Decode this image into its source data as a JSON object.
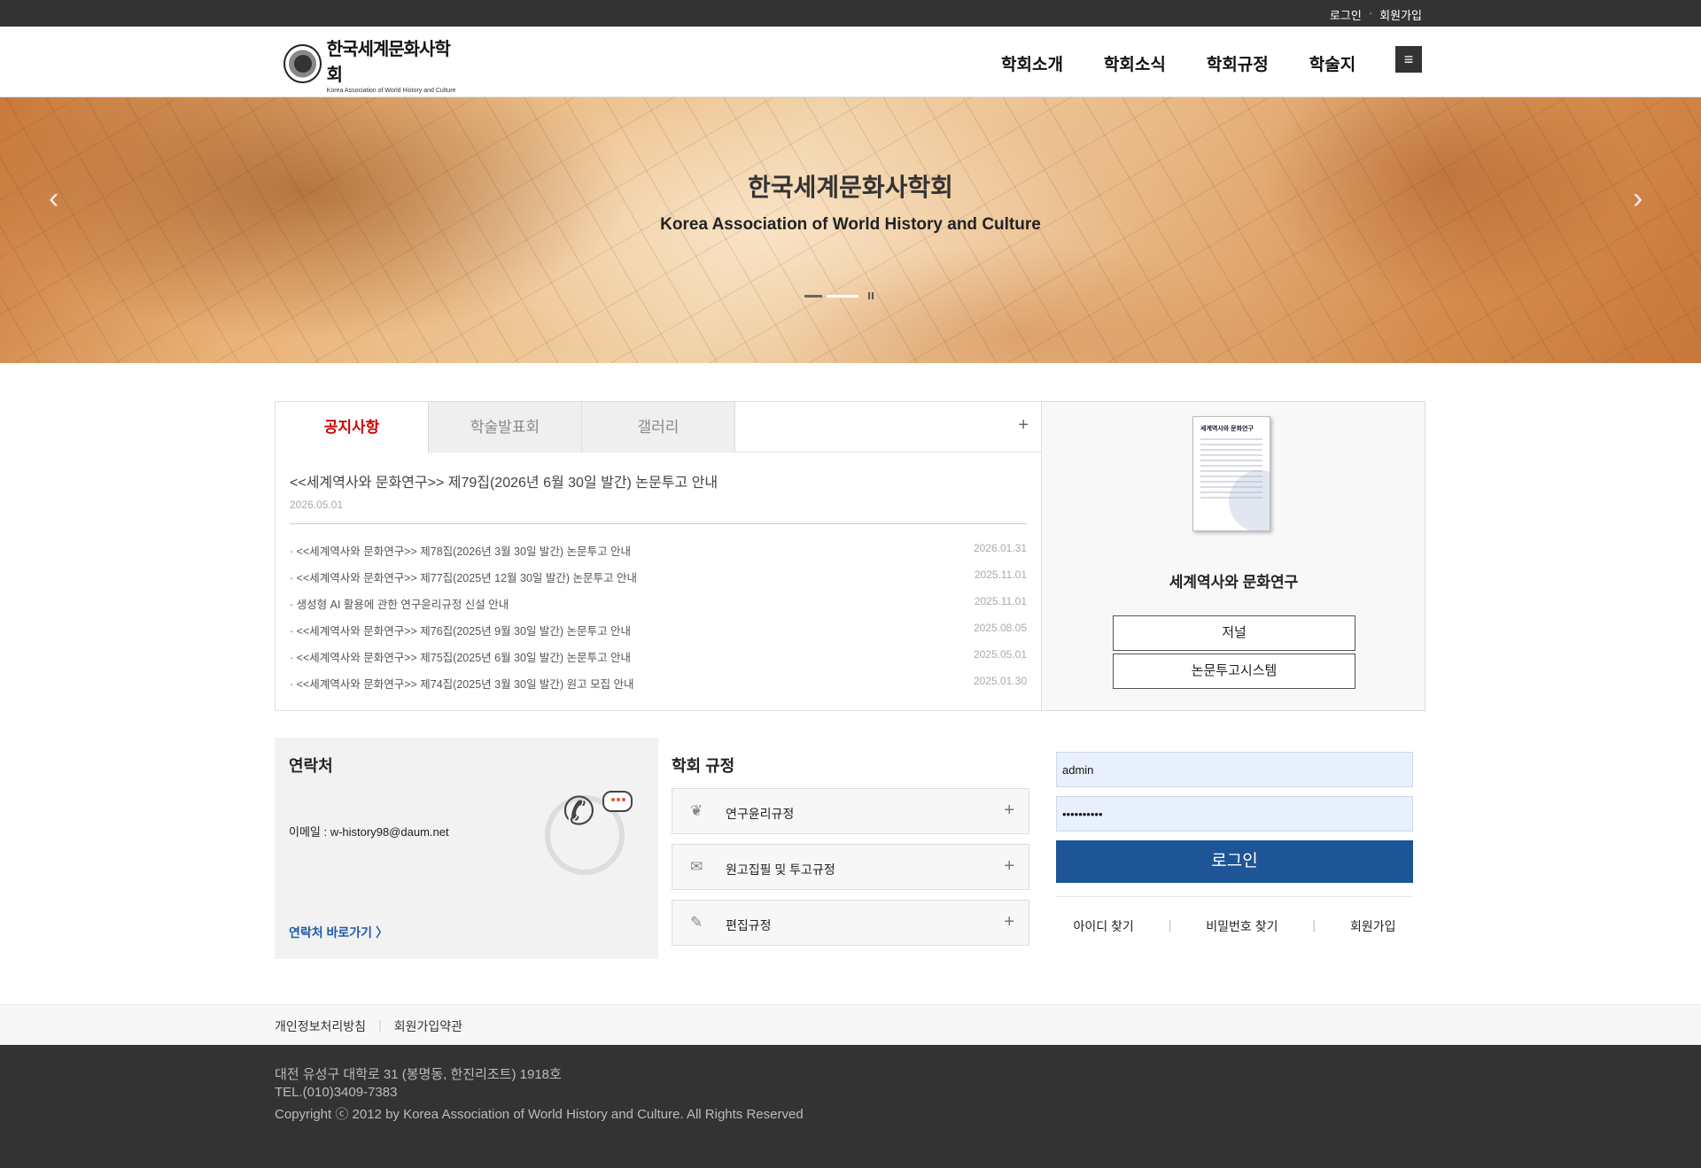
{
  "topbar": {
    "login": "로그인",
    "sep": "·",
    "join": "회원가입"
  },
  "header": {
    "logo_ko": "한국세계문화사학회",
    "logo_en": "Korea Association of World History and Culture",
    "nav": [
      "학회소개",
      "학회소식",
      "학회규정",
      "학술지"
    ],
    "menu_icon": "hamburger-icon"
  },
  "hero": {
    "title": "한국세계문화사학회",
    "subtitle": "Korea Association of World History and Culture",
    "prev": "‹",
    "next": "›",
    "slide_count": 2,
    "active_slide": 2
  },
  "board": {
    "tabs": [
      "공지사항",
      "학술발표회",
      "갤러리"
    ],
    "active_tab": "공지사항",
    "more": "+",
    "featured": {
      "title": "<<세계역사와 문화연구>> 제79집(2026년 6월 30일 발간) 논문투고 안내",
      "date": "2026.05.01"
    },
    "items": [
      {
        "title": "· <<세계역사와 문화연구>> 제78집(2026년 3월 30일 발간) 논문투고 안내",
        "date": "2026.01.31"
      },
      {
        "title": "· <<세계역사와 문화연구>> 제77집(2025년 12월 30일 발간) 논문투고 안내",
        "date": "2025.11.01"
      },
      {
        "title": "· 생성형 AI 활용에 관한 연구윤리규정 신설 안내",
        "date": "2025.11.01"
      },
      {
        "title": "· <<세계역사와 문화연구>> 제76집(2025년 9월 30일 발간) 논문투고 안내",
        "date": "2025.08.05"
      },
      {
        "title": "· <<세계역사와 문화연구>> 제75집(2025년 6월 30일 발간) 논문투고 안내",
        "date": "2025.05.01"
      },
      {
        "title": "· <<세계역사와 문화연구>> 제74집(2025년 3월 30일 발간) 원고 모집 안내",
        "date": "2025.01.30"
      }
    ]
  },
  "journal": {
    "cover_title": "세계역사와 문화연구",
    "title": "세계역사와 문화연구",
    "btn_journal": "저널",
    "btn_submit": "논문투고시스템"
  },
  "contact": {
    "heading": "연락처",
    "email": "이메일 : w-history98@daum.net",
    "link": "연락처 바로가기 〉"
  },
  "rules": {
    "heading": "학회 규정",
    "items": [
      {
        "label": "연구윤리규정",
        "icon": "wheat-icon",
        "glyph": "❦"
      },
      {
        "label": "원고집필 및 투고규정",
        "icon": "scroll-icon",
        "glyph": "✉"
      },
      {
        "label": "편집규정",
        "icon": "pencil-icon",
        "glyph": "✎"
      }
    ],
    "plus": "+"
  },
  "login": {
    "id_value": "admin",
    "pw_value": "••••••••••",
    "button": "로그인",
    "find_id": "아이디 찾기",
    "find_pw": "비밀번호 찾기",
    "join": "회원가입",
    "bar": "|"
  },
  "footer": {
    "privacy": "개인정보처리방침",
    "terms": "회원가입약관",
    "bar": "|",
    "address": "대전 유성구 대학로 31 (봉명동, 한진리조트) 1918호",
    "tel": "TEL.(010)3409-7383",
    "copyright": "Copyright ⓒ 2012 by Korea Association of World History and Culture. All Rights Reserved"
  },
  "colors": {
    "accent": "#1d5597",
    "active_tab": "#d40000",
    "topbar": "#333333"
  }
}
